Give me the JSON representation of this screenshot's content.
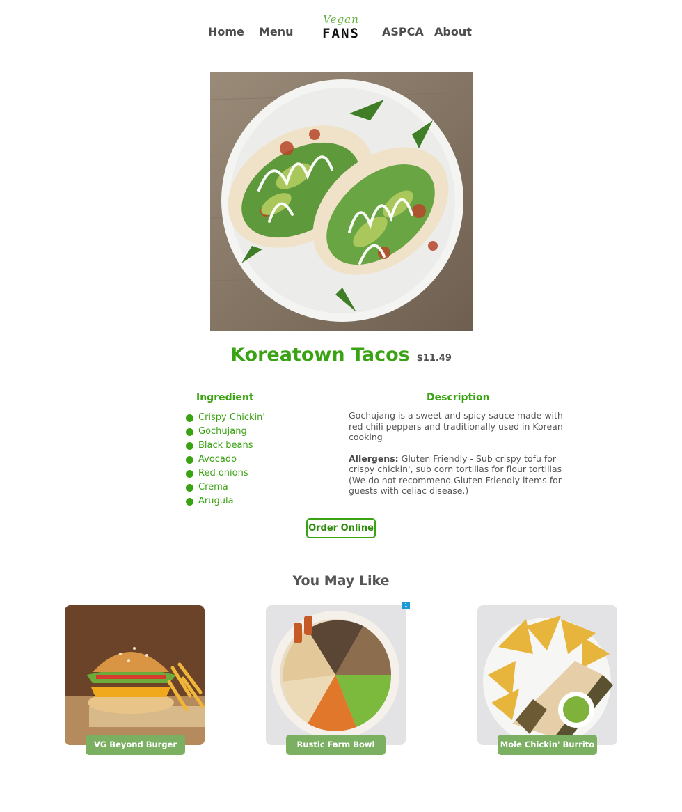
{
  "nav": {
    "home": "Home",
    "menu": "Menu",
    "aspca": "ASPCA",
    "about": "About",
    "logo_script": "Vegan",
    "logo_main": "FANS"
  },
  "product": {
    "title": "Koreatown Tacos",
    "price": "$11.49"
  },
  "ingredients": {
    "heading": "Ingredient",
    "items": [
      "Crispy Chickin'",
      "Gochujang",
      "Black beans",
      "Avocado",
      "Red onions",
      "Crema",
      "Arugula"
    ]
  },
  "description": {
    "heading": "Description",
    "text": "Gochujang is a sweet and spicy sauce made with red chili peppers and traditionally used in Korean cooking",
    "allergens_label": "Allergens:",
    "allergens_text": " Gluten Friendly - Sub crispy tofu for crispy chickin', sub corn tortillas for flour tortillas (We do not recommend Gluten Friendly items for guests with celiac disease.)"
  },
  "order_button": "Order Online",
  "you_may_like": {
    "heading": "You May Like",
    "badge": "1",
    "items": [
      {
        "label": "VG Beyond Burger"
      },
      {
        "label": "Rustic Farm Bowl"
      },
      {
        "label": "Mole Chickin' Burrito"
      }
    ]
  },
  "colors": {
    "accent_green": "#3aa313",
    "label_green": "#7bb062",
    "badge_blue": "#1b9ad6"
  }
}
